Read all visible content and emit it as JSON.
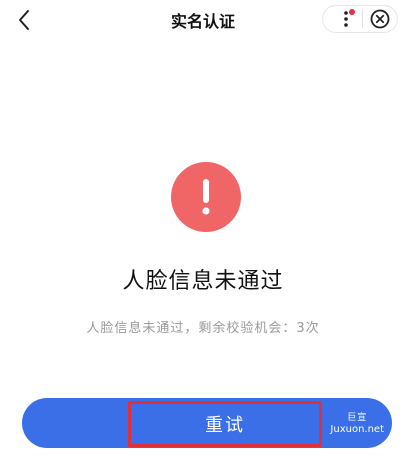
{
  "header": {
    "title": "实名认证",
    "back_icon": "chevron-left-icon",
    "more_icon": "more-vertical-icon",
    "close_icon": "close-circle-icon",
    "notification_dot_color": "#e8323c"
  },
  "status": {
    "icon": "alert-exclamation-icon",
    "icon_color": "#f06566",
    "title": "人脸信息未通过",
    "description": "人脸信息未通过，剩余校验机会：3次"
  },
  "actions": {
    "retry_label": "重试",
    "button_color": "#3a6fe8",
    "highlight_color": "#e0303a"
  },
  "watermark": {
    "line1": "巨宣",
    "line2": "Juxuon.net"
  }
}
